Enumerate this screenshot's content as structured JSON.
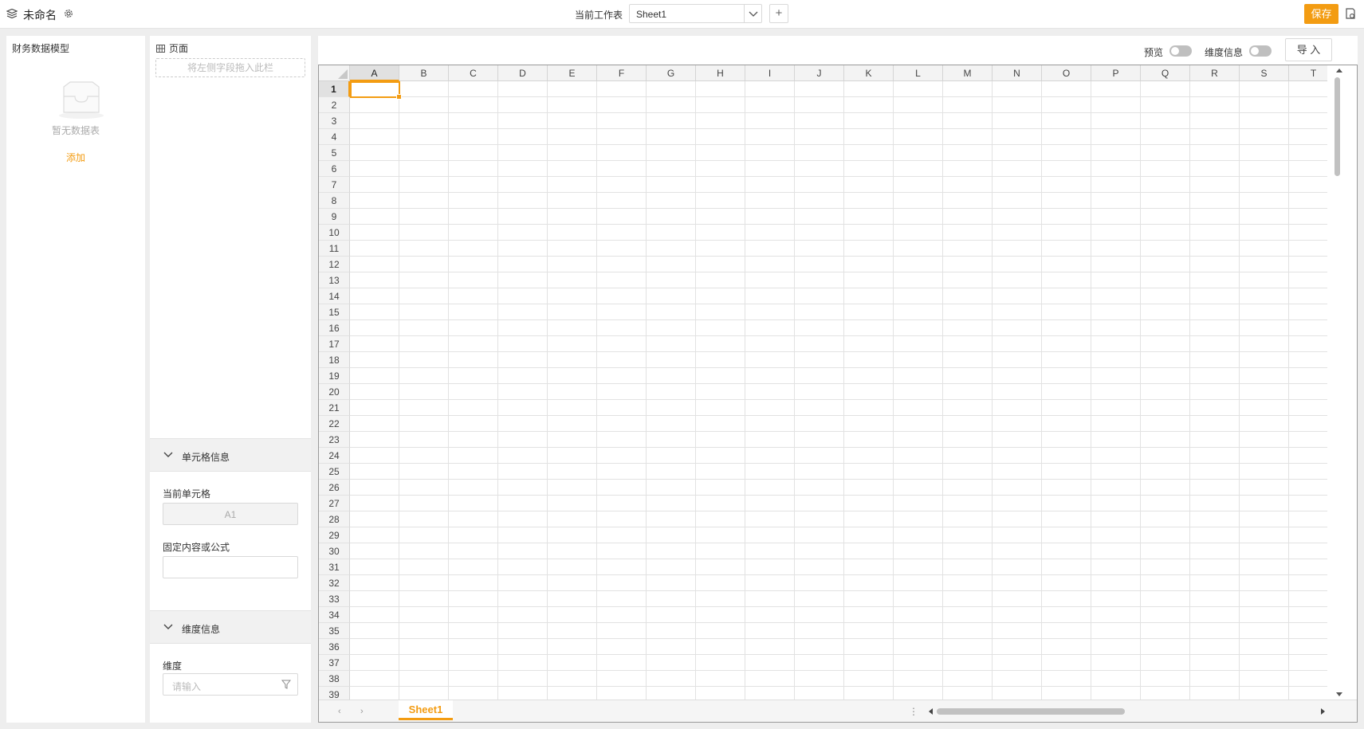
{
  "header": {
    "title": "未命名",
    "current_sheet_label": "当前工作表",
    "current_sheet_value": "Sheet1",
    "add_sheet_label": "+",
    "save_label": "保存",
    "accent_color": "#f39c12"
  },
  "left_panel": {
    "title": "财务数据模型",
    "empty_text": "暂无数据表",
    "add_label": "添加"
  },
  "middle_panel": {
    "page_title": "页面",
    "dropzone_text": "将左侧字段拖入此栏",
    "cell_info": {
      "header": "单元格信息",
      "current_cell_label": "当前单元格",
      "current_cell_value": "A1",
      "formula_label": "固定内容或公式",
      "formula_value": ""
    },
    "dimension_info": {
      "header": "维度信息",
      "dimension_label": "维度",
      "dimension_placeholder": "请输入"
    }
  },
  "toolbar": {
    "preview_label": "预览",
    "preview_on": false,
    "dimension_label": "维度信息",
    "dimension_on": false,
    "import_label": "导 入"
  },
  "spreadsheet": {
    "columns": [
      "A",
      "B",
      "C",
      "D",
      "E",
      "F",
      "G",
      "H",
      "I",
      "J",
      "K",
      "L",
      "M",
      "N",
      "O",
      "P",
      "Q",
      "R",
      "S",
      "T"
    ],
    "rows": [
      "1",
      "2",
      "3",
      "4",
      "5",
      "6",
      "7",
      "8",
      "9",
      "10",
      "11",
      "12",
      "13",
      "14",
      "15",
      "16",
      "17",
      "18",
      "19",
      "20",
      "21",
      "22",
      "23",
      "24",
      "25",
      "26",
      "27",
      "28",
      "29",
      "30",
      "31",
      "32",
      "33",
      "34",
      "35",
      "36",
      "37",
      "38",
      "39"
    ],
    "selected_cell": "A1",
    "sheet_tab": "Sheet1"
  }
}
